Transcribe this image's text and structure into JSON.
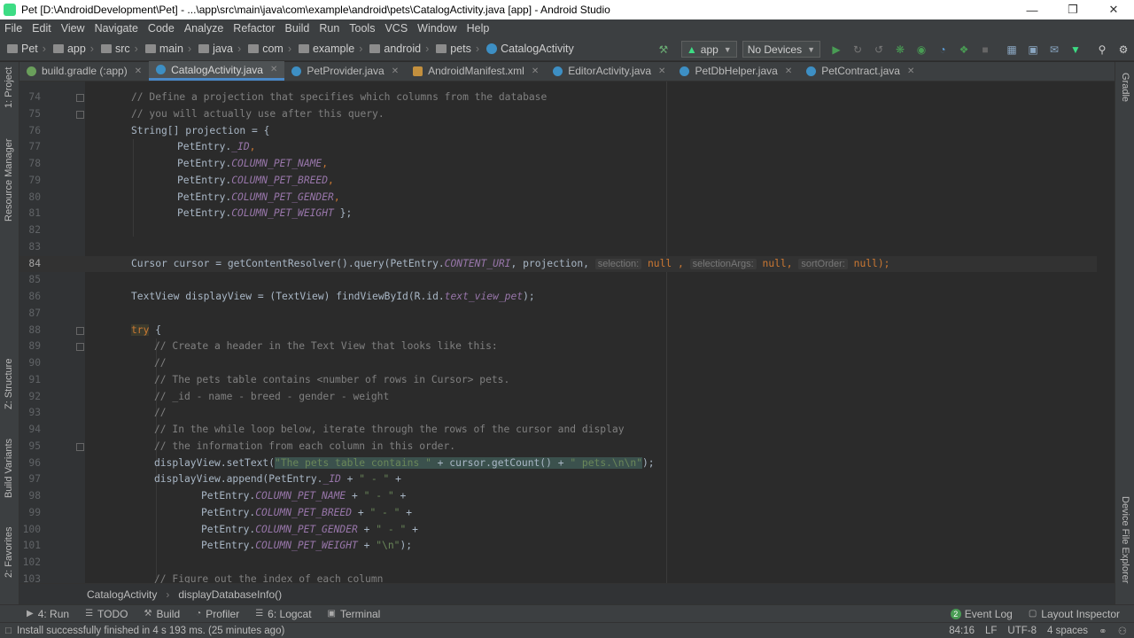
{
  "window": {
    "title": "Pet [D:\\AndroidDevelopment\\Pet] - ...\\app\\src\\main\\java\\com\\example\\android\\pets\\CatalogActivity.java [app] - Android Studio"
  },
  "menu": [
    "File",
    "Edit",
    "View",
    "Navigate",
    "Code",
    "Analyze",
    "Refactor",
    "Build",
    "Run",
    "Tools",
    "VCS",
    "Window",
    "Help"
  ],
  "breadcrumbs": [
    "Pet",
    "app",
    "src",
    "main",
    "java",
    "com",
    "example",
    "android",
    "pets",
    "CatalogActivity"
  ],
  "toolbar": {
    "config": "app",
    "device": "No Devices"
  },
  "tabs": [
    "build.gradle (:app)",
    "CatalogActivity.java",
    "PetProvider.java",
    "AndroidManifest.xml",
    "EditorActivity.java",
    "PetDbHelper.java",
    "PetContract.java"
  ],
  "side_left": [
    "1: Project",
    "Resource Manager",
    "Z: Structure",
    "Build Variants",
    "2: Favorites"
  ],
  "side_right": [
    "Gradle",
    "Device File Explorer"
  ],
  "lines": [
    "74",
    "75",
    "76",
    "77",
    "78",
    "79",
    "80",
    "81",
    "82",
    "83",
    "84",
    "85",
    "86",
    "87",
    "88",
    "89",
    "90",
    "91",
    "92",
    "93",
    "94",
    "95",
    "96",
    "97",
    "98",
    "99",
    "100",
    "101",
    "102",
    "103"
  ],
  "code": {
    "l74": "// Define a projection that specifies which columns from the database",
    "l75": "// you will actually use after this query.",
    "l76": "String[] projection = {",
    "l77a": "PetEntry.",
    "l77b": "_ID",
    "l77c": ",",
    "l78a": "PetEntry.",
    "l78b": "COLUMN_PET_NAME",
    "l78c": ",",
    "l79a": "PetEntry.",
    "l79b": "COLUMN_PET_BREED",
    "l79c": ",",
    "l80a": "PetEntry.",
    "l80b": "COLUMN_PET_GENDER",
    "l80c": ",",
    "l81a": "PetEntry.",
    "l81b": "COLUMN_PET_WEIGHT",
    "l81c": " };",
    "l84a": "Cursor cursor = getContentResolver().query(PetEntry.",
    "l84b": "CONTENT_URI",
    "l84c": ", projection, ",
    "l84h1": "selection:",
    "l84n1": " null ,",
    "l84h2": "selectionArgs:",
    "l84n2": " null, ",
    "l84h3": "sortOrder:",
    "l84n3": " null);",
    "l86a": "TextView displayView = (TextView) findViewById(R.id.",
    "l86b": "text_view_pet",
    "l86c": ");",
    "l88a": "try",
    "l88b": " {",
    "l89": "// Create a header in the Text View that looks like this:",
    "l90": "//",
    "l91": "// The pets table contains <number of rows in Cursor> pets.",
    "l92": "// _id - name - breed - gender - weight",
    "l93": "//",
    "l94": "// In the while loop below, iterate through the rows of the cursor and display",
    "l95": "// the information from each column in this order.",
    "l96a": "displayView.setText(",
    "l96b": "\"The pets table contains \"",
    "l96c": " + cursor.getCount() + ",
    "l96d": "\" pets.\\n\\n\"",
    "l96e": ");",
    "l97a": "displayView.append(PetEntry.",
    "l97b": "_ID",
    "l97c": " + ",
    "l97d": "\" - \"",
    "l97e": " +",
    "l98a": "PetEntry.",
    "l98b": "COLUMN_PET_NAME",
    "l98c": " + ",
    "l98d": "\" - \"",
    "l98e": " +",
    "l99a": "PetEntry.",
    "l99b": "COLUMN_PET_BREED",
    "l99c": " + ",
    "l99d": "\" - \"",
    "l99e": " +",
    "l100a": "PetEntry.",
    "l100b": "COLUMN_PET_GENDER",
    "l100c": " + ",
    "l100d": "\" - \"",
    "l100e": " +",
    "l101a": "PetEntry.",
    "l101b": "COLUMN_PET_WEIGHT",
    "l101c": " + ",
    "l101d": "\"\\n\"",
    "l101e": ");",
    "l103": "// Figure out the index of each column"
  },
  "code_breadcrumb": [
    "CatalogActivity",
    "displayDatabaseInfo()"
  ],
  "tool_windows": [
    "4: Run",
    "TODO",
    "Build",
    "Profiler",
    "6: Logcat",
    "Terminal"
  ],
  "tool_windows_right": {
    "event_log_count": "2",
    "event_log": "Event Log",
    "layout_inspector": "Layout Inspector"
  },
  "status": {
    "message": "Install successfully finished in 4 s 193 ms. (25 minutes ago)",
    "position": "84:16",
    "line_sep": "LF",
    "encoding": "UTF-8",
    "indent": "4 spaces"
  },
  "colors": {
    "accent": "#4a88c7",
    "android_green": "#3ddc84",
    "run_green": "#499c54"
  }
}
